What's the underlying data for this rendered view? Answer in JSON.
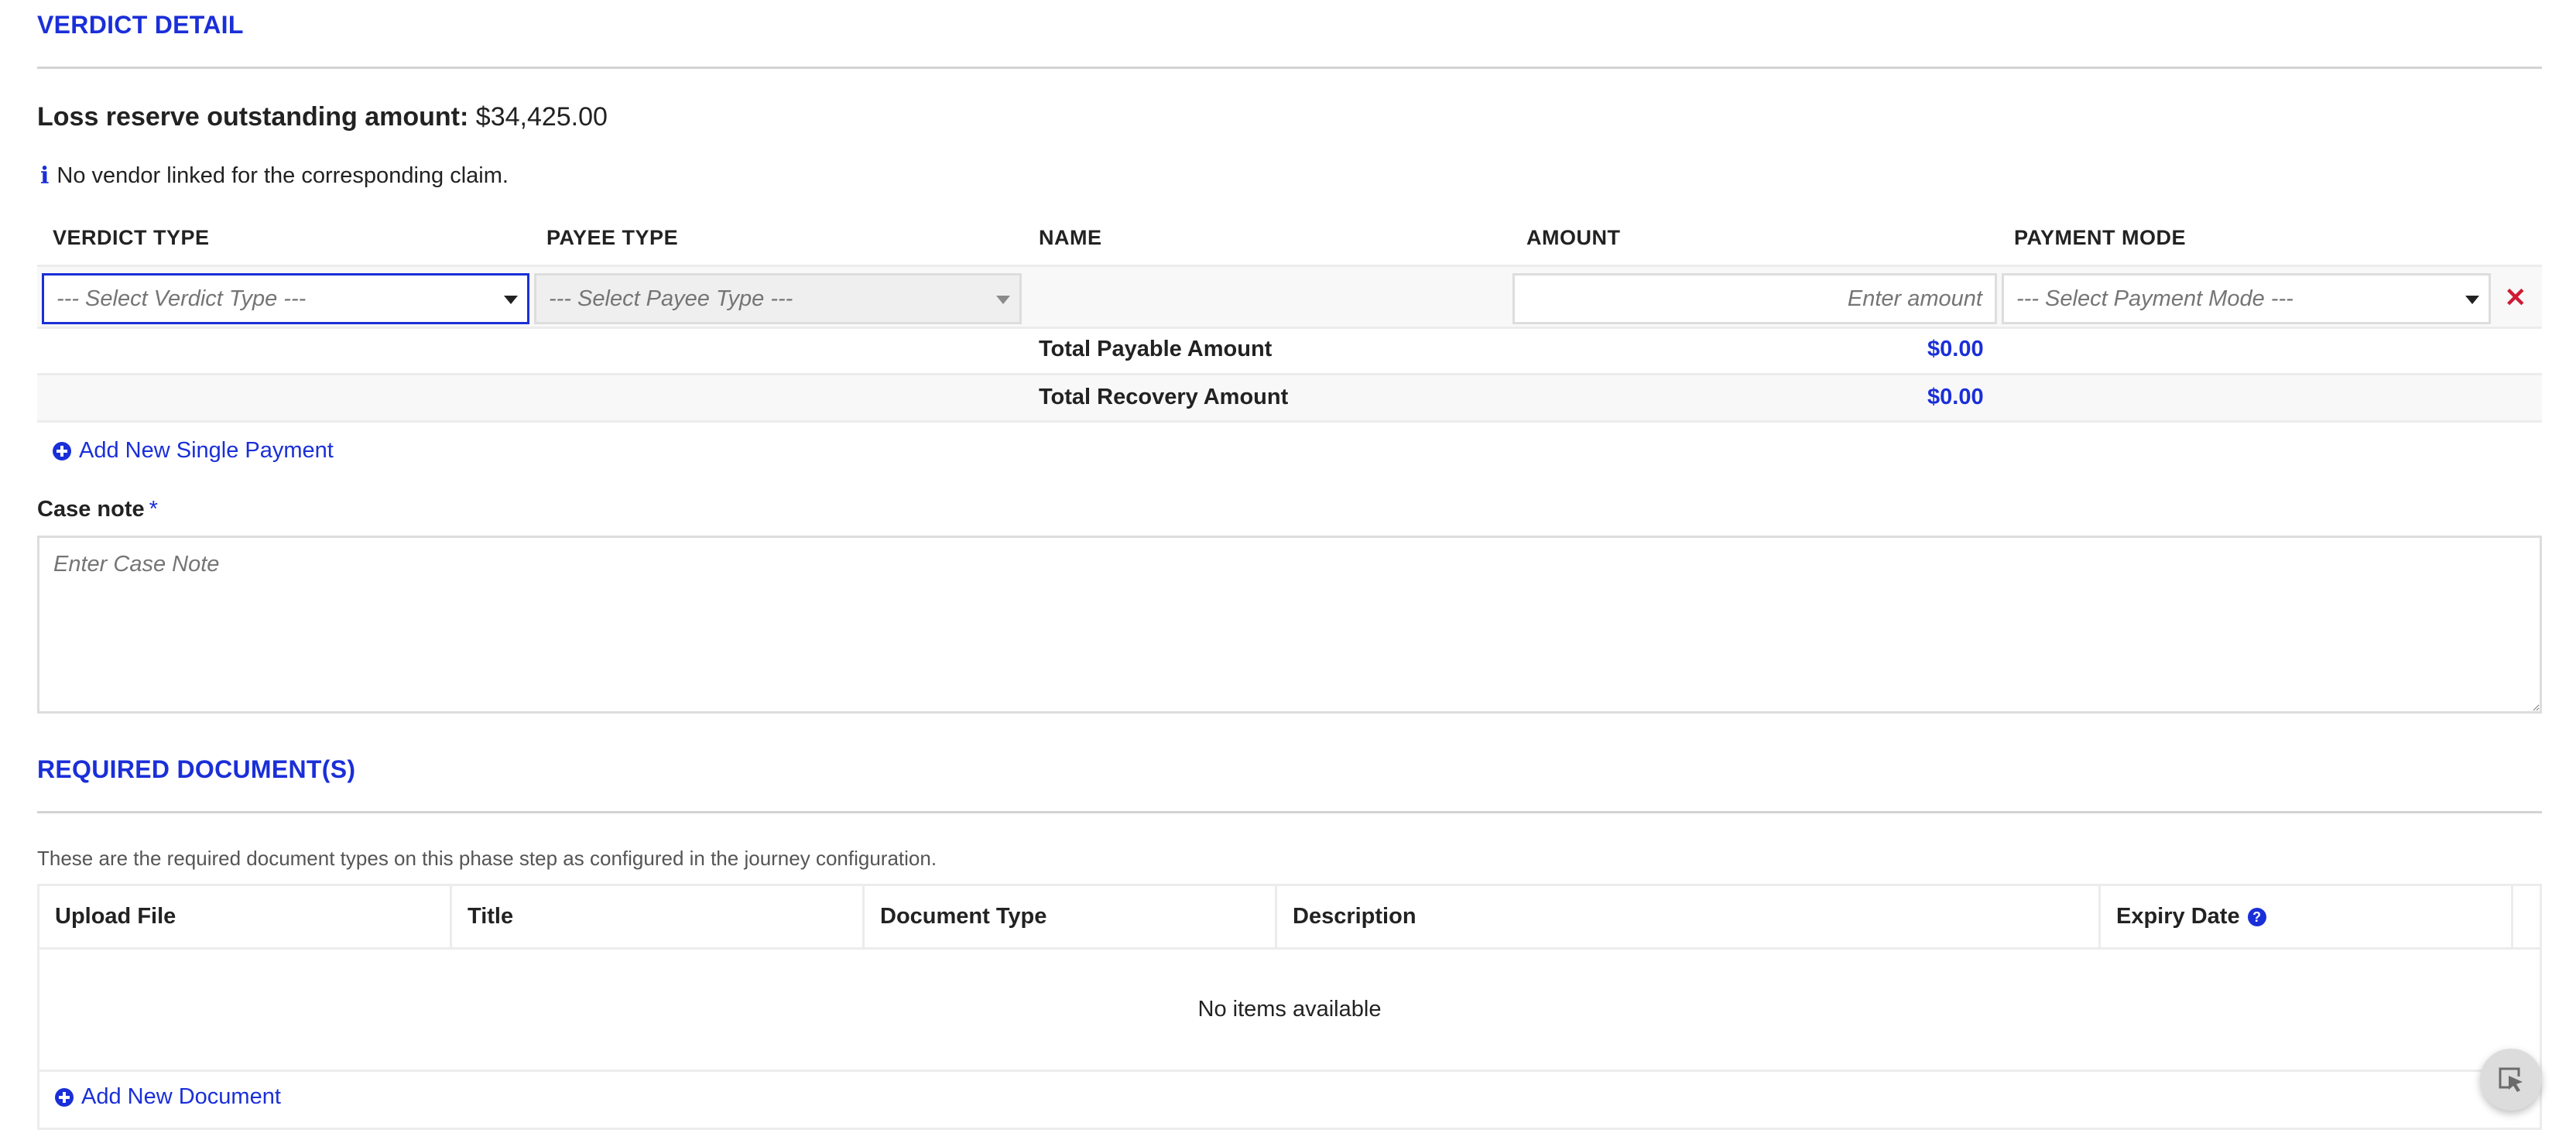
{
  "verdict_section": {
    "title": "VERDICT DETAIL",
    "reserve_label": "Loss reserve outstanding amount:",
    "reserve_value": "$34,425.00",
    "info_icon": "info-icon",
    "info_text": "No vendor linked for the corresponding claim.",
    "columns": [
      "VERDICT TYPE",
      "PAYEE TYPE",
      "NAME",
      "AMOUNT",
      "PAYMENT MODE"
    ],
    "row": {
      "verdict_type_placeholder": "--- Select Verdict Type ---",
      "payee_type_placeholder": "--- Select Payee Type ---",
      "name": "",
      "amount_placeholder": "Enter amount",
      "payment_mode_placeholder": "--- Select Payment Mode ---",
      "remove_icon": "close-icon"
    },
    "totals": [
      {
        "label": "Total Payable Amount",
        "value": "$0.00"
      },
      {
        "label": "Total Recovery Amount",
        "value": "$0.00"
      }
    ],
    "add_payment_label": "Add New Single Payment",
    "case_note_label": "Case note",
    "case_note_required": "*",
    "case_note_placeholder": "Enter Case Note"
  },
  "documents_section": {
    "title": "REQUIRED DOCUMENT(S)",
    "helper_text": "These are the required document types on this phase step as configured in the journey configuration.",
    "columns": [
      "Upload File",
      "Title",
      "Document Type",
      "Description",
      "Expiry Date"
    ],
    "expiry_help_icon": "question-circle-icon",
    "empty_text": "No items available",
    "add_document_label": "Add New Document"
  },
  "floating_button": {
    "icon": "select-cursor-icon"
  },
  "colors": {
    "accent": "#1a2fd8",
    "danger": "#d01a34",
    "border": "#dddddd"
  }
}
